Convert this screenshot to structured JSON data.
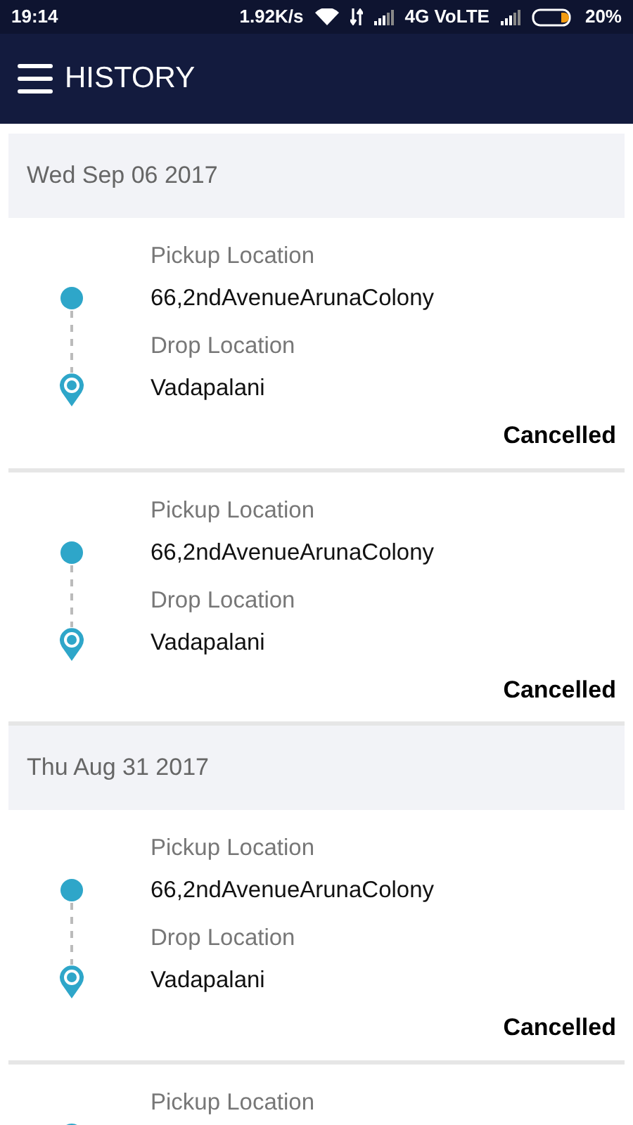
{
  "status_bar": {
    "time": "19:14",
    "speed": "1.92K/s",
    "network": "4G VoLTE",
    "battery": "20%"
  },
  "header": {
    "title": "HISTORY"
  },
  "groups": [
    {
      "date": "Wed Sep 06 2017",
      "trips": [
        {
          "pickup_label": "Pickup Location",
          "pickup": "66,2ndAvenueArunaColony",
          "drop_label": "Drop Location",
          "drop": "Vadapalani",
          "status": "Cancelled"
        },
        {
          "pickup_label": "Pickup Location",
          "pickup": "66,2ndAvenueArunaColony",
          "drop_label": "Drop Location",
          "drop": "Vadapalani",
          "status": "Cancelled"
        }
      ]
    },
    {
      "date": "Thu Aug 31 2017",
      "trips": [
        {
          "pickup_label": "Pickup Location",
          "pickup": "66,2ndAvenueArunaColony",
          "drop_label": "Drop Location",
          "drop": "Vadapalani",
          "status": "Cancelled"
        },
        {
          "pickup_label": "Pickup Location"
        }
      ]
    }
  ]
}
